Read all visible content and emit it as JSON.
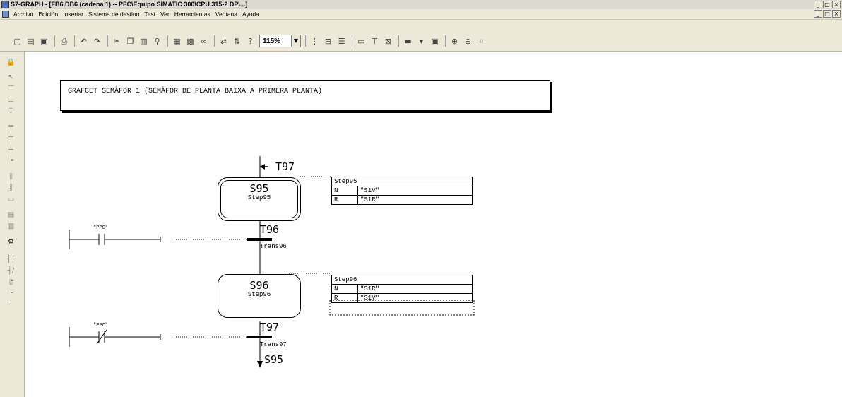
{
  "window": {
    "title": "S7-GRAPH - [FB6,DB6 (cadena 1) -- PFC\\Equipo SIMATIC 300\\CPU 315-2 DP\\...]",
    "controls": [
      "_",
      "□",
      "×"
    ]
  },
  "menu": {
    "items": [
      "Archivo",
      "Edición",
      "Insertar",
      "Sistema de destino",
      "Test",
      "Ver",
      "Herramientas",
      "Ventana",
      "Ayuda"
    ]
  },
  "toolbar": {
    "zoom_value": "115%"
  },
  "grafcet": {
    "title": "GRAFCET SEMÀFOR 1 (SEMÀFOR DE PLANTA BAIXA A PRIMERA PLANTA)",
    "incoming_jump": "T97",
    "steps": [
      {
        "name": "S95",
        "comment": "Step95",
        "actions_title": "Step95",
        "actions": [
          {
            "qual": "N",
            "operand": "\"S1V\""
          },
          {
            "qual": "R",
            "operand": "\"S1R\""
          }
        ]
      },
      {
        "name": "S96",
        "comment": "Step96",
        "actions_title": "Step96",
        "actions": [
          {
            "qual": "N",
            "operand": "\"S1R\""
          },
          {
            "qual": "R",
            "operand": "\"S1V\""
          }
        ]
      }
    ],
    "transitions": [
      {
        "name": "T96",
        "comment": "Trans96",
        "contact_label": "\"PPC\""
      },
      {
        "name": "T97",
        "comment": "Trans97",
        "contact_label": "\"PPC\""
      }
    ],
    "outgoing_jump": "S95"
  },
  "colors": {
    "background": "#ffffff",
    "chrome": "#ece9d8",
    "ink": "#000000"
  }
}
